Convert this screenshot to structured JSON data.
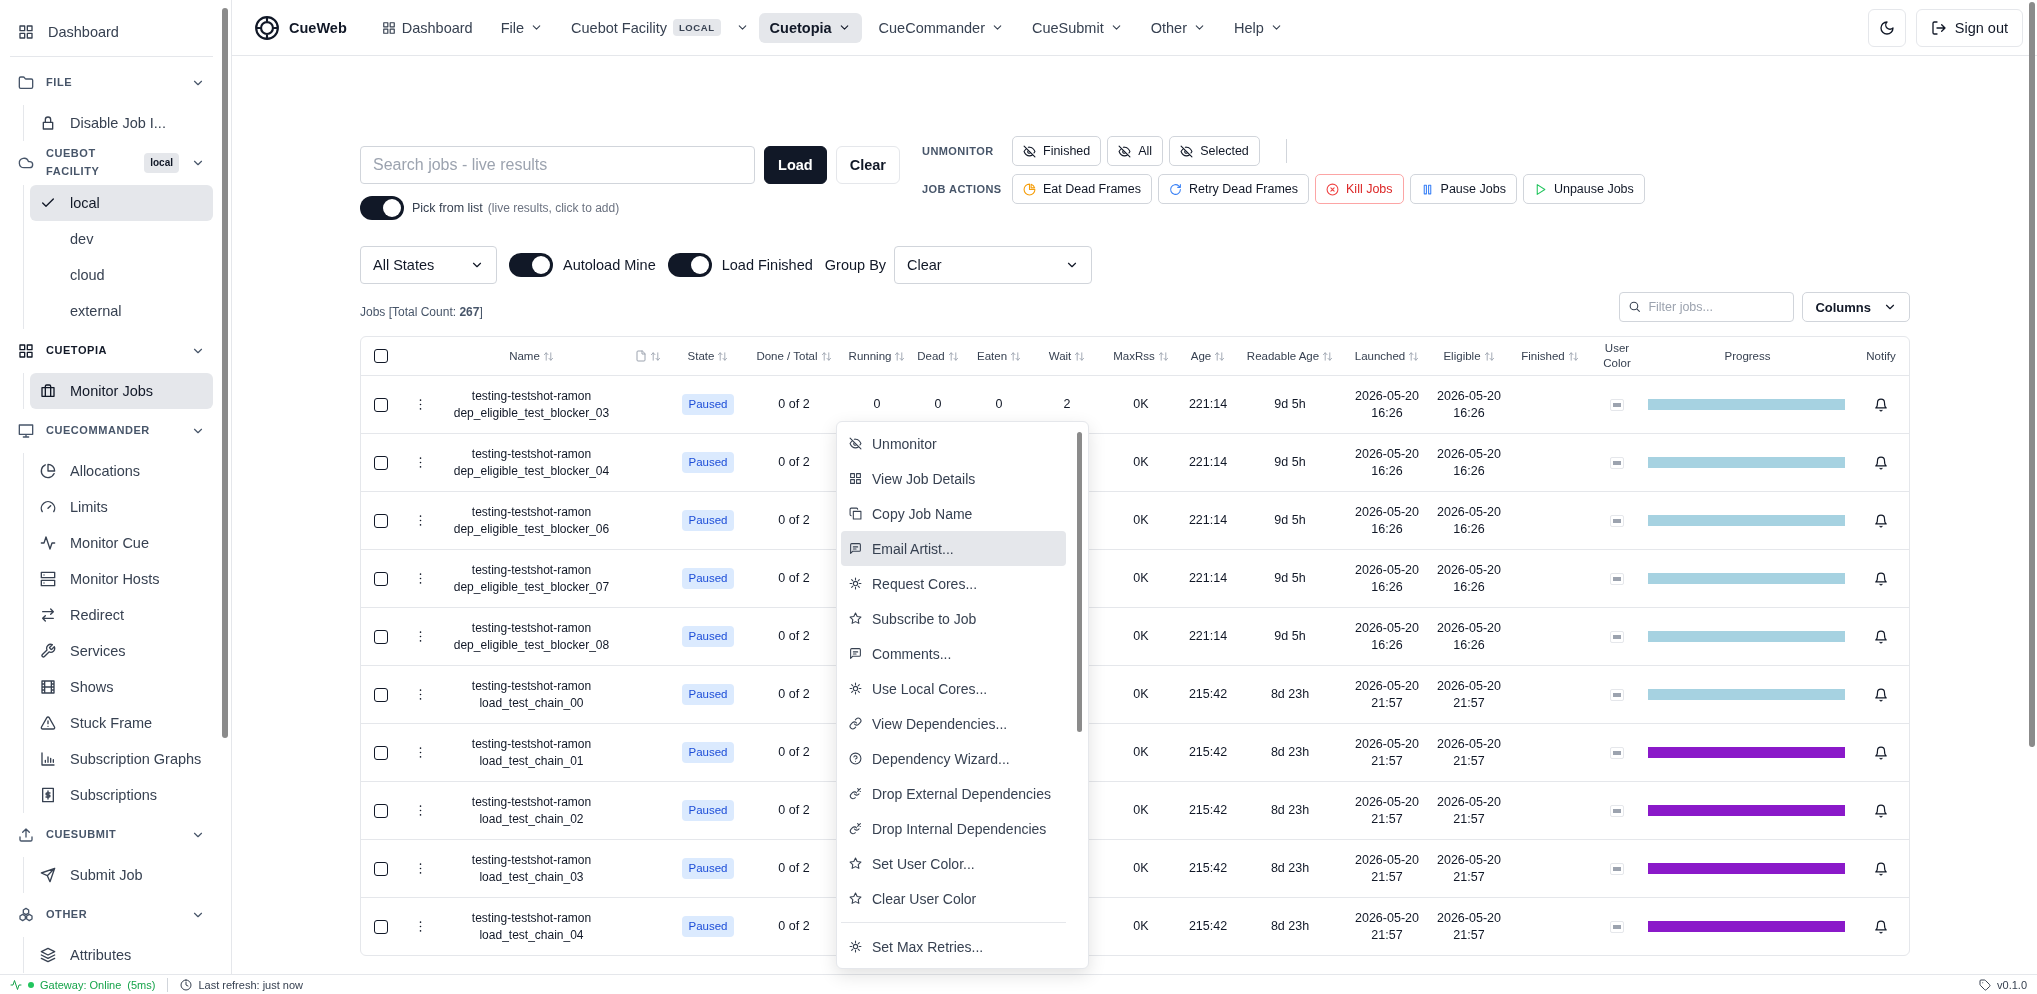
{
  "sidebar": {
    "top": {
      "label": "Dashboard",
      "kind": "grid"
    },
    "sections": [
      {
        "title": "FILE",
        "kind": "folder",
        "expanded": true,
        "active": false,
        "items": [
          {
            "label": "Disable Job I...",
            "kind": "lock",
            "selected": false
          }
        ]
      },
      {
        "title": "CUEBOT FACILITY",
        "kind": "cloud",
        "badge": "local",
        "expanded": true,
        "active": false,
        "items": [
          {
            "label": "local",
            "checked": true,
            "selected": true
          },
          {
            "label": "dev",
            "checked": false,
            "selected": false
          },
          {
            "label": "cloud",
            "checked": false,
            "selected": false
          },
          {
            "label": "external",
            "checked": false,
            "selected": false
          }
        ]
      },
      {
        "title": "CUETOPIA",
        "kind": "grid",
        "expanded": true,
        "active": true,
        "items": [
          {
            "label": "Monitor Jobs",
            "kind": "briefcase",
            "selected": true
          }
        ]
      },
      {
        "title": "CUECOMMANDER",
        "kind": "monitor",
        "expanded": true,
        "active": false,
        "items": [
          {
            "label": "Allocations",
            "kind": "pie",
            "selected": false
          },
          {
            "label": "Limits",
            "kind": "gauge",
            "selected": false
          },
          {
            "label": "Monitor Cue",
            "kind": "pulse",
            "selected": false
          },
          {
            "label": "Monitor Hosts",
            "kind": "server",
            "selected": false
          },
          {
            "label": "Redirect",
            "kind": "arrows",
            "selected": false
          },
          {
            "label": "Services",
            "kind": "wrench",
            "selected": false
          },
          {
            "label": "Shows",
            "kind": "film",
            "selected": false
          },
          {
            "label": "Stuck Frame",
            "kind": "alert",
            "selected": false
          },
          {
            "label": "Subscription Graphs",
            "kind": "bars",
            "selected": false
          },
          {
            "label": "Subscriptions",
            "kind": "dollar",
            "selected": false
          }
        ]
      },
      {
        "title": "CUESUBMIT",
        "kind": "upload",
        "expanded": true,
        "active": false,
        "items": [
          {
            "label": "Submit Job",
            "kind": "send",
            "selected": false
          }
        ]
      },
      {
        "title": "OTHER",
        "kind": "boxes",
        "expanded": true,
        "active": false,
        "items": [
          {
            "label": "Attributes",
            "kind": "layers",
            "selected": false
          }
        ]
      }
    ]
  },
  "nav": {
    "brand": "CueWeb",
    "items": [
      {
        "label": "Dashboard",
        "kind": "link",
        "selected": false
      },
      {
        "label": "File",
        "kind": "menu",
        "selected": false
      },
      {
        "label": "Cuebot Facility",
        "badge": "LOCAL",
        "kind": "split",
        "selected": false
      },
      {
        "label": "Cuetopia",
        "kind": "menu",
        "selected": true
      },
      {
        "label": "CueCommander",
        "kind": "menu",
        "selected": false
      },
      {
        "label": "CueSubmit",
        "kind": "menu",
        "selected": false
      },
      {
        "label": "Other",
        "kind": "menu",
        "selected": false
      },
      {
        "label": "Help",
        "kind": "menu",
        "selected": false
      }
    ],
    "sign_out": "Sign out"
  },
  "search": {
    "placeholder": "Search jobs - live results",
    "load": "Load",
    "clear": "Clear",
    "pick": {
      "label": "Pick from list",
      "hint": "(live results, click to add)",
      "on": true
    }
  },
  "unmonitor": {
    "label": "UNMONITOR",
    "buttons": [
      "Finished",
      "All",
      "Selected"
    ]
  },
  "job_actions": {
    "label": "JOB ACTIONS",
    "buttons": [
      {
        "label": "Eat Dead Frames",
        "kind": "eat"
      },
      {
        "label": "Retry Dead Frames",
        "kind": "retry"
      },
      {
        "label": "Kill Jobs",
        "kind": "kill"
      },
      {
        "label": "Pause Jobs",
        "kind": "pause"
      },
      {
        "label": "Unpause Jobs",
        "kind": "unpause"
      }
    ]
  },
  "filters": {
    "state": "All States",
    "toggles": [
      {
        "label": "Autoload Mine",
        "on": true
      },
      {
        "label": "Load Finished",
        "on": true
      }
    ],
    "group_by_label": "Group By",
    "group_by": "Clear"
  },
  "jobs_count": "Jobs [Total Count: **267**]",
  "filter": {
    "placeholder": "Filter jobs..."
  },
  "columns_button": "Columns",
  "table": {
    "select_all": {
      "checked": false
    },
    "columns": [
      {
        "label": "Name",
        "kind": "text",
        "sortable": true
      },
      {
        "kind": "icon",
        "sortable": true
      },
      {
        "label": "State",
        "kind": "text",
        "sortable": true
      },
      {
        "label": "Done / Total",
        "kind": "text",
        "sortable": true
      },
      {
        "label": "Running",
        "kind": "text",
        "sortable": true
      },
      {
        "label": "Dead",
        "kind": "text",
        "sortable": true
      },
      {
        "label": "Eaten",
        "kind": "text",
        "sortable": true
      },
      {
        "label": "Wait",
        "kind": "text",
        "sortable": true
      },
      {
        "label": "MaxRss",
        "kind": "text",
        "sortable": true
      },
      {
        "label": "Age",
        "kind": "text",
        "sortable": true
      },
      {
        "label": "Readable Age",
        "kind": "text",
        "sortable": true
      },
      {
        "label": "Launched",
        "kind": "text",
        "sortable": true
      },
      {
        "label": "Eligible",
        "kind": "text",
        "sortable": true
      },
      {
        "label": "Finished",
        "kind": "text",
        "sortable": true
      },
      {
        "label": "User Color",
        "kind": "text",
        "sortable": false
      },
      {
        "label": "Progress",
        "kind": "text",
        "sortable": false
      },
      {
        "label": "Notify",
        "kind": "text",
        "sortable": false
      }
    ],
    "rows": [
      {
        "checked": false,
        "name": "testing-testshot-ramon dep_eligible_test_blocker_03",
        "state": "Paused",
        "done_total": "0 of 2",
        "running": "0",
        "dead": "0",
        "eaten": "0",
        "wait": "2",
        "maxrss": "0K",
        "age": "221:14",
        "readable_age": "9d 5h",
        "launched": "2026-05-20 16:26",
        "eligible": "2026-05-20 16:26",
        "progress": {
          "level": 1,
          "color": "#a6d2e1"
        }
      },
      {
        "checked": false,
        "name": "testing-testshot-ramon dep_eligible_test_blocker_04",
        "state": "Paused",
        "done_total": "0 of 2",
        "maxrss": "0K",
        "age": "221:14",
        "readable_age": "9d 5h",
        "launched": "2026-05-20 16:26",
        "eligible": "2026-05-20 16:26",
        "progress": {
          "level": 1,
          "color": "#a6d2e1"
        }
      },
      {
        "checked": false,
        "name": "testing-testshot-ramon dep_eligible_test_blocker_06",
        "state": "Paused",
        "done_total": "0 of 2",
        "maxrss": "0K",
        "age": "221:14",
        "readable_age": "9d 5h",
        "launched": "2026-05-20 16:26",
        "eligible": "2026-05-20 16:26",
        "progress": {
          "level": 1,
          "color": "#a6d2e1"
        }
      },
      {
        "checked": false,
        "name": "testing-testshot-ramon dep_eligible_test_blocker_07",
        "state": "Paused",
        "done_total": "0 of 2",
        "maxrss": "0K",
        "age": "221:14",
        "readable_age": "9d 5h",
        "launched": "2026-05-20 16:26",
        "eligible": "2026-05-20 16:26",
        "progress": {
          "level": 1,
          "color": "#a6d2e1"
        }
      },
      {
        "checked": false,
        "name": "testing-testshot-ramon dep_eligible_test_blocker_08",
        "state": "Paused",
        "done_total": "0 of 2",
        "maxrss": "0K",
        "age": "221:14",
        "readable_age": "9d 5h",
        "launched": "2026-05-20 16:26",
        "eligible": "2026-05-20 16:26",
        "progress": {
          "level": 1,
          "color": "#a6d2e1"
        }
      },
      {
        "checked": false,
        "name": "testing-testshot-ramon load_test_chain_00",
        "state": "Paused",
        "done_total": "0 of 2",
        "maxrss": "0K",
        "age": "215:42",
        "readable_age": "8d 23h",
        "launched": "2026-05-20 21:57",
        "eligible": "2026-05-20 21:57",
        "progress": {
          "level": 1,
          "color": "#a6d2e1"
        }
      },
      {
        "checked": false,
        "name": "testing-testshot-ramon load_test_chain_01",
        "state": "Paused",
        "done_total": "0 of 2",
        "maxrss": "0K",
        "age": "215:42",
        "readable_age": "8d 23h",
        "launched": "2026-05-20 21:57",
        "eligible": "2026-05-20 21:57",
        "progress": {
          "level": 1,
          "color": "#8a19c9"
        }
      },
      {
        "checked": false,
        "name": "testing-testshot-ramon load_test_chain_02",
        "state": "Paused",
        "done_total": "0 of 2",
        "maxrss": "0K",
        "age": "215:42",
        "readable_age": "8d 23h",
        "launched": "2026-05-20 21:57",
        "eligible": "2026-05-20 21:57",
        "progress": {
          "level": 1,
          "color": "#8a19c9"
        }
      },
      {
        "checked": false,
        "name": "testing-testshot-ramon load_test_chain_03",
        "state": "Paused",
        "done_total": "0 of 2",
        "maxrss": "0K",
        "age": "215:42",
        "readable_age": "8d 23h",
        "launched": "2026-05-20 21:57",
        "eligible": "2026-05-20 21:57",
        "progress": {
          "level": 1,
          "color": "#8a19c9"
        }
      },
      {
        "checked": false,
        "name": "testing-testshot-ramon load_test_chain_04",
        "state": "Paused",
        "done_total": "0 of 2",
        "maxrss": "0K",
        "age": "215:42",
        "readable_age": "8d 23h",
        "launched": "2026-05-20 21:57",
        "eligible": "2026-05-20 21:57",
        "progress": {
          "level": 1,
          "color": "#8a19c9"
        }
      }
    ]
  },
  "context_menu": {
    "items": [
      {
        "label": "Unmonitor",
        "kind": "eyeoff",
        "selected": false,
        "divider_before": false
      },
      {
        "label": "View Job Details",
        "kind": "grid",
        "selected": false,
        "divider_before": false
      },
      {
        "label": "Copy Job Name",
        "kind": "copy",
        "selected": false,
        "divider_before": false
      },
      {
        "label": "Email Artist...",
        "kind": "msg",
        "selected": true,
        "divider_before": false
      },
      {
        "label": "Request Cores...",
        "kind": "gear",
        "selected": false,
        "divider_before": false
      },
      {
        "label": "Subscribe to Job",
        "kind": "star",
        "selected": false,
        "divider_before": false
      },
      {
        "label": "Comments...",
        "kind": "msg",
        "selected": false,
        "divider_before": false
      },
      {
        "label": "Use Local Cores...",
        "kind": "gear",
        "selected": false,
        "divider_before": false
      },
      {
        "label": "View Dependencies...",
        "kind": "link",
        "selected": false,
        "divider_before": false
      },
      {
        "label": "Dependency Wizard...",
        "kind": "help",
        "selected": false,
        "divider_before": false
      },
      {
        "label": "Drop External Dependencies",
        "kind": "unlink",
        "selected": false,
        "divider_before": false
      },
      {
        "label": "Drop Internal Dependencies",
        "kind": "unlink",
        "selected": false,
        "divider_before": false
      },
      {
        "label": "Set User Color...",
        "kind": "star",
        "selected": false,
        "divider_before": false
      },
      {
        "label": "Clear User Color",
        "kind": "star",
        "selected": false,
        "divider_before": false
      },
      {
        "label": "Set Max Retries...",
        "kind": "gear",
        "selected": false,
        "divider_before": true
      }
    ]
  },
  "status_bar": {
    "online": true,
    "gateway": "Gateway: Online",
    "latency": "(5ms)",
    "refresh": "Last refresh: just now",
    "version": "v0.1.0"
  }
}
